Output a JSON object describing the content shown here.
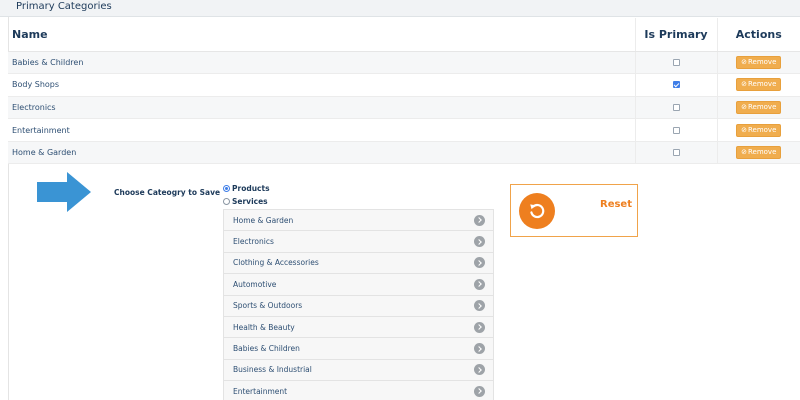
{
  "panel": {
    "title": "Primary Categories"
  },
  "table": {
    "headers": {
      "name": "Name",
      "primary": "Is Primary",
      "actions": "Actions"
    },
    "rows": [
      {
        "name": "Babies & Children",
        "primary": false,
        "action": "Remove"
      },
      {
        "name": "Body Shops",
        "primary": true,
        "action": "Remove"
      },
      {
        "name": "Electronics",
        "primary": false,
        "action": "Remove"
      },
      {
        "name": "Entertainment",
        "primary": false,
        "action": "Remove"
      },
      {
        "name": "Home & Garden",
        "primary": false,
        "action": "Remove"
      }
    ]
  },
  "chooser": {
    "label": "Choose Cateogry to Save",
    "options": [
      {
        "label": "Products",
        "selected": true
      },
      {
        "label": "Services",
        "selected": false
      }
    ],
    "categories": [
      "Home & Garden",
      "Electronics",
      "Clothing & Accessories",
      "Automotive",
      "Sports & Outdoors",
      "Health & Beauty",
      "Babies & Children",
      "Business & Industrial",
      "Entertainment"
    ]
  },
  "reset": {
    "label": "Reset"
  },
  "colors": {
    "accent": "#ee7f1f",
    "remove": "#f0ad4e",
    "arrow": "#3a94d4",
    "check": "#3f7ee8"
  },
  "icons": {
    "remove": "remove-circle-icon",
    "reset": "reset-undo-icon",
    "arrow": "arrow-right-icon",
    "chevron": "chevron-right-icon"
  }
}
